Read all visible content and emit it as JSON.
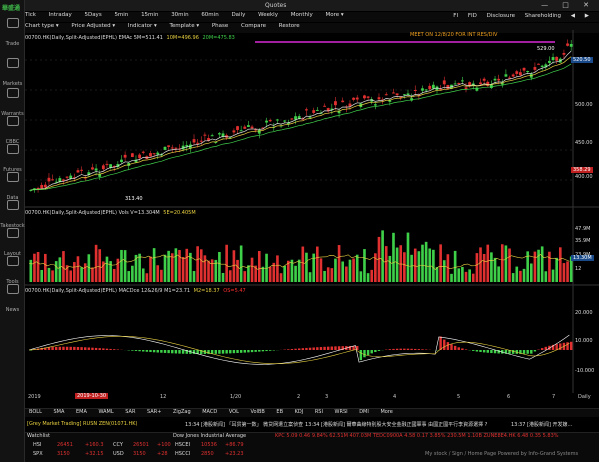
{
  "window": {
    "title": "Quotes",
    "controls": "— □ ✕"
  },
  "sidebar": {
    "logo": "華盛通",
    "items": [
      {
        "label": "Trade"
      },
      {
        "label": "Markets"
      },
      {
        "label": "Warrants"
      },
      {
        "label": "CBBC"
      },
      {
        "label": "Futures"
      },
      {
        "label": "Data"
      },
      {
        "label": "Takestock"
      },
      {
        "label": "Layout"
      },
      {
        "label": "Tools"
      },
      {
        "label": "News"
      }
    ]
  },
  "toolbar": {
    "periods": [
      "Tick",
      "Intraday",
      "5Days",
      "5min",
      "15min",
      "30min",
      "60min",
      "Daily",
      "Weekly",
      "Monthly",
      "More ▾"
    ],
    "right": [
      "FI",
      "FID",
      "Disclosure",
      "Shareholding",
      "◀",
      "▶"
    ],
    "menu": [
      "Chart type ▾",
      "Price Adjusted ▾",
      "Indicator ▾",
      "Template ▾",
      "Phase",
      "Compare",
      "Restore"
    ]
  },
  "price_panel": {
    "header": [
      {
        "text": "00700.HK(Daily,Split-Adjusted)EPHL) EMAc 5M=511.41",
        "color": "#dddddd"
      },
      {
        "text": "10M=496.96",
        "color": "#e8d040"
      },
      {
        "text": "20M=475.83",
        "color": "#3fd04a"
      }
    ],
    "annotation": "MEET ON 12/8/20     FOR INT RES/DIV",
    "annotation_color": "#f0a020",
    "high_label": "529.00",
    "low_label": "313.40",
    "y_ticks": [
      "500.00",
      "450.00",
      "400.00"
    ],
    "tags": [
      {
        "text": "520.50",
        "bg": "#1a4a8a",
        "fg": "#ffffff"
      },
      {
        "text": "358.29",
        "bg": "#c02020",
        "fg": "#ffffff"
      }
    ]
  },
  "volume_panel": {
    "header": [
      {
        "text": "00700.HK(Daily,Split-Adjusted)EPHL) Vols V=13.304M",
        "color": "#dddddd"
      },
      {
        "text": "5E=20.405M",
        "color": "#e8d040"
      }
    ],
    "y_ticks": [
      "47.9M",
      "35.9M",
      "23.9M",
      "12"
    ],
    "tag": {
      "text": "13.30M",
      "bg": "#1a4a8a",
      "fg": "#ffffff"
    }
  },
  "macd_panel": {
    "header": [
      {
        "text": "00700.HK(Daily,Split-Adjusted)EPHL) MACDce 12&26/9 M1=23.71",
        "color": "#dddddd"
      },
      {
        "text": "M2=18.37",
        "color": "#e8d040"
      },
      {
        "text": "OS=5.47",
        "color": "#ff3030"
      }
    ],
    "y_ticks": [
      "20.000",
      "10.000",
      "-10.000"
    ]
  },
  "xaxis": {
    "labels": [
      "2019",
      "12",
      "1/20",
      "2",
      "3",
      "4",
      "5",
      "6",
      "7"
    ],
    "highlight": "2019-10-30",
    "right_label": "Daily"
  },
  "indicators": [
    "BOLL",
    "SMA",
    "EMA",
    "WAML",
    "SAR",
    "SAR+",
    "ZigZag",
    "MACD",
    "VOL",
    "VolBB",
    "EB",
    "KDJ",
    "RSI",
    "WRSI",
    "DMI",
    "More"
  ],
  "news": {
    "watch": "[Grey Market Trading] RUSN ZEN(01071.HK)",
    "items": [
      "13:34 [港股新闻] 「耳贯第一数」 微贷网遭立案侦查",
      "13:34 [港股新闻] 爾華曲線特別股大安全金融正國軍事 由國正國平行李資源選擇 ?",
      "13:37 [港股新闻] 开发嬢..."
    ]
  },
  "bottom": {
    "watchlist_label": "Watchlist",
    "index_title": "Dow Jones Industrial Average",
    "rows": [
      {
        "name": "HSI",
        "val": "26451",
        "chg": "+160.3",
        "ccy": "CCY",
        "v2": "26501",
        "c2": "+100",
        "sym": "HSCEI",
        "v3": "10536",
        "c3": "+86.79"
      },
      {
        "name": "SPX",
        "val": "3150",
        "chg": "+32.15",
        "ccy": "USD",
        "v2": "3150",
        "c2": "+28",
        "sym": "HSCCI",
        "v3": "2850",
        "c3": "+23.23"
      }
    ],
    "ticker": "KPC 5.09 0.46 9.84% 62.51M 407.03M  TEDC0900A 4.58 0.17 3.85% 230.5M 1.10B  ZUNE8E4.HK 6.48 0.35 5.83%",
    "powered": "My stock / Sign / Home Page  Powered by Info-Grand Systems"
  },
  "colors": {
    "up": "#3fd04a",
    "down": "#e03030",
    "ema5": "#dddddd",
    "ema10": "#e8d040",
    "ema20": "#3fd04a",
    "accent": "#1a4a8a"
  }
}
